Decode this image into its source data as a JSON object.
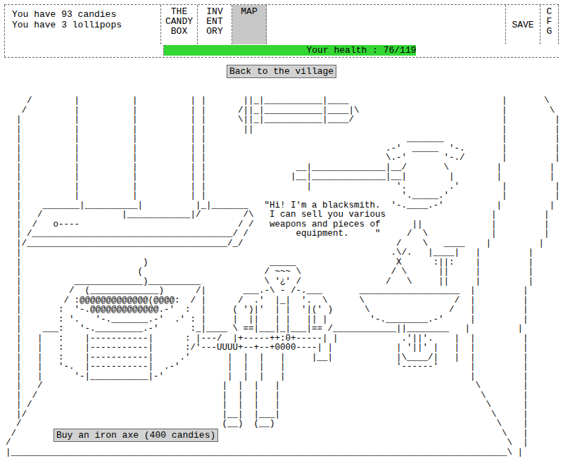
{
  "status": {
    "candies": "You have 93 candies",
    "lollipops": "You have 3 lollipops"
  },
  "tabs": [
    {
      "lines": [
        "THE",
        "CANDY",
        "BOX"
      ],
      "selected": false
    },
    {
      "lines": [
        "INV",
        "ENT",
        "ORY"
      ],
      "selected": false
    },
    {
      "lines": [
        "MAP"
      ],
      "selected": true
    }
  ],
  "save": "SAVE",
  "cfg": [
    "C",
    "F",
    "G"
  ],
  "health": {
    "label": "Your health : 76/119",
    "level": 0.639
  },
  "back_button": "Back to the village",
  "scene": {
    "art": [
      "    /        |          |          | |       ||_|___________|____                             |       \\",
      "   /         |          |          | |      /||_|___________|____|\\                           |        \\",
      "  |          |          |          | |      \\||_|___________|____/                            |         |",
      "  |          |          |          | |       ||                                               |         |",
      "  |          |          |          | |                                      _______           |         |",
      "  |          |          |          | |                                  .-'  _____  '-.       |         |",
      "  |          |          |          | |                                  \\.-'       '-./       |         |",
      "  |          |          |          | |                 __|______________|__/       \\         |         |",
      "  |          |          |          | |                |__|______________|__|        |        |         |",
      "  |          |          |          | |                   |                '.        .'        |         |",
      "  |          |          |          | |                                     '._____.'          |         |",
      "  |    _______|__________|          |_|_______   \"Hi! I'm a blacksmith.  '-.____.-'          |         |",
      "  |   /               |____________|/        /\\   I can sell you various                    |         |",
      "  |  /   o----                              / /   weapons and pieces of      ||             |         |",
      "  | /______________________________________/ /         equipment.     \"     /  \\            |         |",
      "  |/______________________________________/_/                             /    \\   ____    |         |",
      "  |                                                                      .\\/.   |____|   |         |",
      "  |                       )                       _____                   X      :||:    |         |",
      "  |                      (                       / ~~~ \\                 / \\      ||     |         |",
      "  |          _____________)__________            \\ '¿' /                /   \\     ||     |         |",
      "  |         /  (_____________)      /|       ___.-\\ - /-.___       ___________________  |         |",
      "  |        / :@@@@@@@@@@@@@(@@@@:  / |      /  .'  |_|  '.  \\      \\                 /  |         |",
      "  |       :  '-.@@@@@@@@@@@@@.-'  :  |     ( ')|'  | |  '|(' )      \\               /   |         |",
      "  |       : '.   '-._______.-'  .' : |     |  ||   | |   || |        '-.________.-'     |         |",
      "  |    ___:   '-._________.-'      :_|____ \\ ==|___|_|___|== /____________||________   |         |",
      "  |   |   :    |-----------|      : |---/  |+-----++:0+-----| |            .'||'.    |  |         |",
      "  |   |   :    |-----------|      :/'---UUUU+--+--+0000----| |            | '||' |   |  |         |",
      "  |   |   :    |-----------|     .'       |  |  |   |     |__|            |\\____/|   |  |         |",
      "  |   |   '-.  |-----------|  .-'         |  |  |   |                     '------'      |         |",
      "  |   |      '-|___________|-'            |  |  |   |                                   |         |",
      "  |   /                                  |  |  |   |                                     \\        |",
      "  |  /                                   |  |  |   |                                      \\       |",
      "  | /                                    |  |  |   |                                       \\      |",
      "  |/                                     |__|  |___|                                        \\     |",
      "  /                                      (__)  (__)                                          \\    |",
      " /                                                                                            \\   |",
      "/                                                                                              \\  |",
      "|______________________________________________________________________________________________\\ |"
    ]
  },
  "buy_button": "Buy an iron axe (400 candies)"
}
